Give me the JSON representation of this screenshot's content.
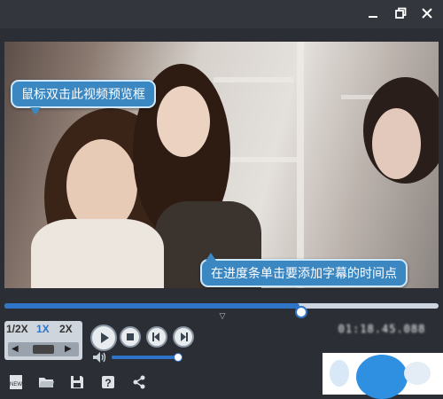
{
  "window": {
    "controls": [
      "minimize-icon",
      "maximize-icon",
      "close-icon"
    ]
  },
  "preview": {
    "tooltip_dblclick": "鼠标双击此视频预览框",
    "tooltip_progress": "在进度条单击要添加字幕的时间点"
  },
  "progress": {
    "value_fraction": 0.68
  },
  "speed": {
    "options": [
      "1/2X",
      "1X",
      "2X"
    ],
    "selected": "1X",
    "step_left": "◀",
    "step_right": "▶"
  },
  "playback": {
    "icons": [
      "play-icon",
      "stop-icon",
      "previous-icon",
      "next-icon"
    ]
  },
  "volume": {
    "value_fraction": 0.95
  },
  "timecode": "01:18.45.088",
  "toolbar": {
    "icons": [
      "new-icon",
      "open-folder-icon",
      "save-icon",
      "help-icon",
      "share-icon"
    ]
  },
  "colors": {
    "accent": "#2f74c6",
    "tooltip": "#3b87c2",
    "background": "#2b2f35"
  }
}
